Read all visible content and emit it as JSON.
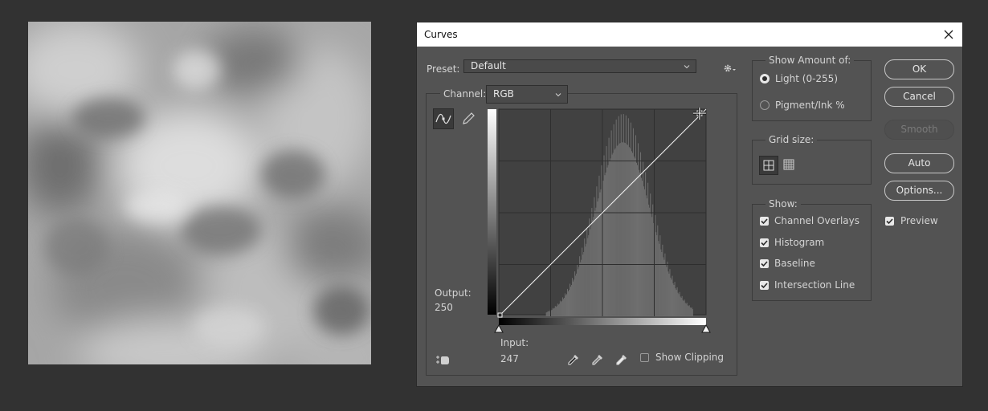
{
  "dialog": {
    "title": "Curves"
  },
  "preset": {
    "label": "Preset:",
    "value": "Default"
  },
  "channel": {
    "label": "Channel:",
    "value": "RGB"
  },
  "output": {
    "label": "Output:",
    "value": "250"
  },
  "input": {
    "label": "Input:",
    "value": "247"
  },
  "show_clipping": {
    "label": "Show Clipping",
    "checked": false
  },
  "show_amount": {
    "title": "Show Amount of:",
    "options": [
      {
        "label": "Light  (0-255)",
        "selected": true
      },
      {
        "label": "Pigment/Ink %",
        "selected": false
      }
    ]
  },
  "grid_size": {
    "title": "Grid size:",
    "selected": "simple"
  },
  "show": {
    "title": "Show:",
    "items": [
      {
        "label": "Channel Overlays",
        "checked": true
      },
      {
        "label": "Histogram",
        "checked": true
      },
      {
        "label": "Baseline",
        "checked": true
      },
      {
        "label": "Intersection Line",
        "checked": true
      }
    ]
  },
  "buttons": {
    "ok": "OK",
    "cancel": "Cancel",
    "smooth": "Smooth",
    "auto": "Auto",
    "options": "Options..."
  },
  "preview": {
    "label": "Preview",
    "checked": true
  },
  "icons": {
    "close": "close-icon",
    "preset_settings": "gear-icon",
    "curve_tool": "curve-tool-icon",
    "pencil_tool": "pencil-icon",
    "targeted_adjust": "hand-adjust-icon",
    "eyedroppers": [
      "black-point-eyedropper-icon",
      "gray-point-eyedropper-icon",
      "white-point-eyedropper-icon"
    ]
  },
  "colors": {
    "dialog_bg": "#535353",
    "workspace_bg": "#323232",
    "grid_bg": "#414141",
    "histogram": "#6f6f6f"
  },
  "curve": {
    "points": [
      [
        0,
        0
      ],
      [
        255,
        255
      ]
    ],
    "selected_point": [
      247,
      250
    ]
  },
  "histogram": {
    "range": [
      0,
      255
    ],
    "peak_level": 152,
    "spread": 34,
    "note_range": [
      58,
      238
    ]
  }
}
